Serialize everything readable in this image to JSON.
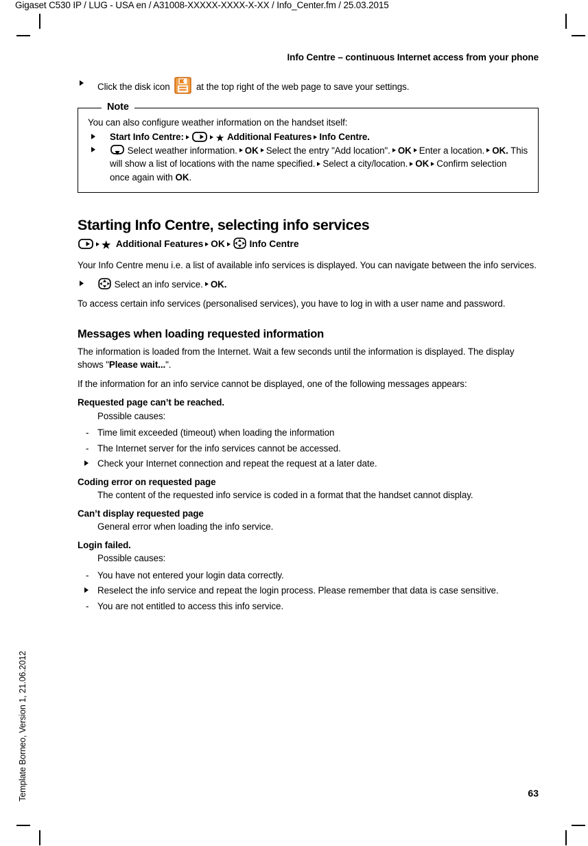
{
  "file_info": "Gigaset C530 IP / LUG - USA en / A31008-XXXXX-XXXX-X-XX / Info_Center.fm / 25.03.2015",
  "template_label": "Template Borneo, Version 1, 21.06.2012",
  "running_head": "Info Centre – continuous Internet access from your phone",
  "page_number": "63",
  "colors": {
    "disk_icon_orange": "#E8821E",
    "disk_icon_orange_dark": "#D2701A",
    "text": "#000000",
    "page_background": "#FFFFFF"
  },
  "intro_step": {
    "part1": "Click the disk icon",
    "icon": "floppy-disk-save-icon",
    "part2": "at the top right of the web page to save your settings."
  },
  "note_box": {
    "caption": "Note",
    "intro": "You can also configure weather information on the handset itself:",
    "step1": {
      "label": "Start Info Centre:",
      "menu_key_icon": "handset-menu-key-icon",
      "star_icon": "star-icon",
      "item1": "Additional Features",
      "item2": "Info Centre",
      "trailing": "."
    },
    "step2": {
      "nav_down_icon": "navigation-key-down-icon",
      "t1": "Select weather information.",
      "ok1": "OK",
      "t2": "Select the entry \"Add location\".",
      "ok2": "OK",
      "t3": "Enter a location.",
      "ok3": "OK.",
      "t4": "This will show a list of locations with the name specified.",
      "t5": "Select a city/location.",
      "ok4": "OK",
      "t6": "Confirm selection once again with",
      "ok5": "OK",
      "trailing": "."
    }
  },
  "section": {
    "heading": "Starting Info Centre, selecting info services",
    "menu_path": {
      "menu_key_icon": "handset-menu-key-icon",
      "star_icon": "star-icon",
      "item1": "Additional Features",
      "item2": "OK",
      "nav_icon": "navigation-key-4way-icon",
      "item3": "Info Centre"
    },
    "para1": "Your Info Centre menu i.e. a list of available info services is displayed. You can navigate between the info services.",
    "step": {
      "nav_icon": "navigation-key-4way-icon",
      "text": "Select an info service.",
      "ok": "OK."
    },
    "para2": "To access certain info services (personalised services), you have to log in with a user name and password."
  },
  "messages_section": {
    "heading": "Messages when loading requested information",
    "para1_a": "The information is loaded from the Internet. Wait a few seconds until the information is displayed. The display shows \"",
    "para1_bold": "Please wait...",
    "para1_b": "\".",
    "para2": "If the information for an info service cannot be displayed, one of the following messages appears:",
    "errors": [
      {
        "title": "Requested page can’t be reached.",
        "lead": "Possible causes:",
        "items": [
          {
            "marker": "dash",
            "text": "Time limit exceeded (timeout) when loading the information"
          },
          {
            "marker": "dash",
            "text": "The Internet server for the info services cannot be accessed."
          },
          {
            "marker": "triangle",
            "text": "Check your Internet connection and repeat the request at a later date."
          }
        ]
      },
      {
        "title": "Coding error on requested page",
        "body": "The content of the requested info service is coded in a format that the handset cannot display."
      },
      {
        "title": "Can’t display requested page",
        "body": "General error when loading the info service."
      },
      {
        "title": "Login failed.",
        "lead": "Possible causes:",
        "items": [
          {
            "marker": "dash",
            "text": "You have not entered your login data correctly."
          },
          {
            "marker": "triangle",
            "text": "Reselect the info service and repeat the login process. Please remember that data is case sensitive."
          },
          {
            "marker": "dash",
            "text": "You are not entitled to access this info service."
          }
        ]
      }
    ]
  }
}
